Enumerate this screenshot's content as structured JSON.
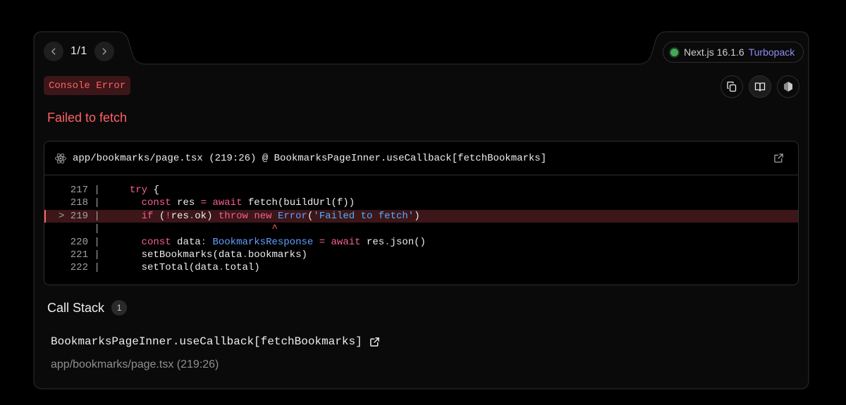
{
  "pagination": {
    "prev_icon": "chevron-left-icon",
    "next_icon": "chevron-right-icon",
    "label": "1/1"
  },
  "version": {
    "status_color": "#46a758",
    "label": "Next.js 16.1.6",
    "bundler": "Turbopack"
  },
  "error": {
    "type": "Console Error",
    "message": "Failed to fetch"
  },
  "toolbar": {
    "copy_icon": "copy-icon",
    "docs_icon": "book-icon",
    "node_icon": "nodejs-icon"
  },
  "code_frame": {
    "file_label": "app/bookmarks/page.tsx (219:26) @ BookmarksPageInner.useCallback[fetchBookmarks]",
    "lines": [
      {
        "num": "217"
      },
      {
        "num": "218"
      },
      {
        "num": "> 219"
      },
      {
        "num": ""
      },
      {
        "num": "220"
      },
      {
        "num": "221"
      },
      {
        "num": "222"
      }
    ]
  },
  "call_stack": {
    "title": "Call Stack",
    "count": "1",
    "frames": [
      {
        "function": "BookmarksPageInner.useCallback[fetchBookmarks]",
        "location": "app/bookmarks/page.tsx (219:26)"
      }
    ]
  },
  "colors": {
    "error": "#ff6166",
    "accent": "#8f8cf7",
    "background": "#0a0a0a",
    "border": "#2e2e2e"
  }
}
